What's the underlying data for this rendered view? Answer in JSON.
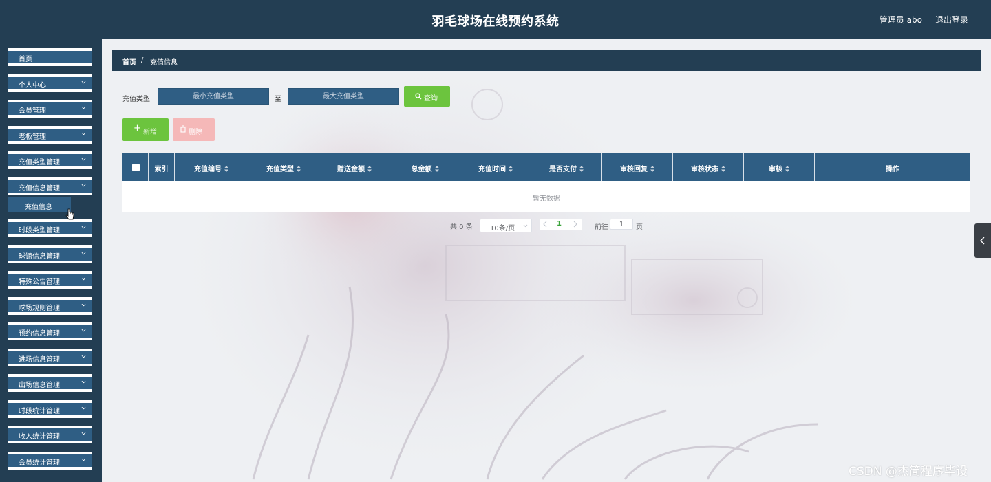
{
  "header": {
    "title": "羽毛球场在线预约系统",
    "user": "管理员 abo",
    "logout": "退出登录"
  },
  "sidebar": {
    "items": [
      {
        "label": "首页",
        "has_children": false
      },
      {
        "label": "个人中心",
        "has_children": true
      },
      {
        "label": "会员管理",
        "has_children": true
      },
      {
        "label": "老板管理",
        "has_children": true
      },
      {
        "label": "充值类型管理",
        "has_children": true
      },
      {
        "label": "充值信息管理",
        "has_children": true,
        "expanded": true
      },
      {
        "label": "时段类型管理",
        "has_children": true
      },
      {
        "label": "球馆信息管理",
        "has_children": true
      },
      {
        "label": "特殊公告管理",
        "has_children": true
      },
      {
        "label": "球场规则管理",
        "has_children": true
      },
      {
        "label": "预约信息管理",
        "has_children": true
      },
      {
        "label": "进场信息管理",
        "has_children": true
      },
      {
        "label": "出场信息管理",
        "has_children": true
      },
      {
        "label": "时段统计管理",
        "has_children": true
      },
      {
        "label": "收入统计管理",
        "has_children": true
      },
      {
        "label": "会员统计管理",
        "has_children": true
      }
    ],
    "submenu": {
      "label": "充值信息"
    }
  },
  "breadcrumb": {
    "home": "首页",
    "separator": "/",
    "current": "充值信息"
  },
  "search": {
    "label": "充值类型",
    "min_placeholder": "最小充值类型",
    "to": "至",
    "max_placeholder": "最大充值类型",
    "query_button": "查询"
  },
  "actions": {
    "add": "新增",
    "delete": "删除"
  },
  "table": {
    "columns": [
      {
        "label": "索引",
        "sortable": false
      },
      {
        "label": "充值编号",
        "sortable": true
      },
      {
        "label": "充值类型",
        "sortable": true
      },
      {
        "label": "赠送金额",
        "sortable": true
      },
      {
        "label": "总金额",
        "sortable": true
      },
      {
        "label": "充值时间",
        "sortable": true
      },
      {
        "label": "是否支付",
        "sortable": true
      },
      {
        "label": "审核回复",
        "sortable": true
      },
      {
        "label": "审核状态",
        "sortable": true
      },
      {
        "label": "审核",
        "sortable": true
      },
      {
        "label": "操作",
        "sortable": false
      }
    ],
    "empty_text": "暂无数据"
  },
  "pagination": {
    "total_text": "共 0 条",
    "page_size": "10条/页",
    "current_page": "1",
    "goto_label": "前往",
    "goto_value": "1",
    "page_suffix": "页"
  },
  "watermark": "CSDN @杰简程序毕设",
  "colors": {
    "header_bg": "#233e53",
    "menu_bg": "#2f5e84",
    "accent_green": "#6cc43e",
    "delete_disabled": "#f5b8b8"
  }
}
